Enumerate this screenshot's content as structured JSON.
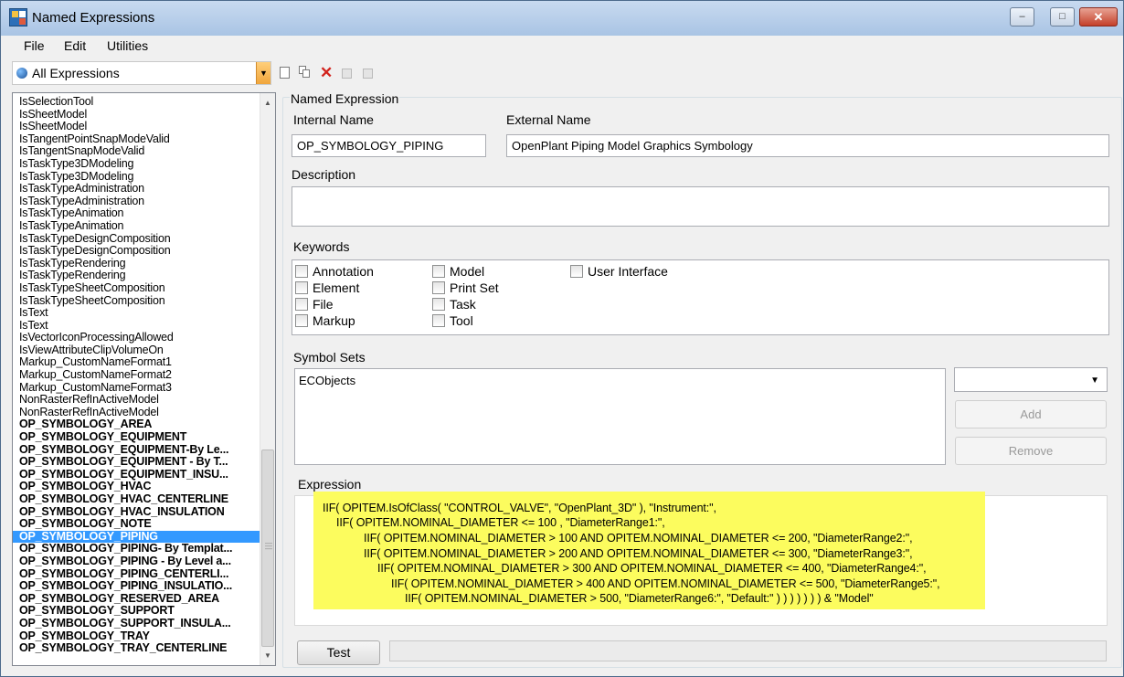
{
  "window": {
    "title": "Named Expressions",
    "controls": {
      "minimize": "–",
      "maximize": "□",
      "close": "✕"
    }
  },
  "menu": [
    "File",
    "Edit",
    "Utilities"
  ],
  "toolbar": {
    "filter_value": "All Expressions",
    "icons": [
      "new-expression-icon",
      "copy-expression-icon",
      "delete-icon",
      "save-icon",
      "save-all-icon"
    ]
  },
  "expression_list": [
    {
      "label": "IsSelectionTool",
      "bold": false
    },
    {
      "label": "IsSheetModel",
      "bold": false
    },
    {
      "label": "IsSheetModel",
      "bold": false
    },
    {
      "label": "IsTangentPointSnapModeValid",
      "bold": false
    },
    {
      "label": "IsTangentSnapModeValid",
      "bold": false
    },
    {
      "label": "IsTaskType3DModeling",
      "bold": false
    },
    {
      "label": "IsTaskType3DModeling",
      "bold": false
    },
    {
      "label": "IsTaskTypeAdministration",
      "bold": false
    },
    {
      "label": "IsTaskTypeAdministration",
      "bold": false
    },
    {
      "label": "IsTaskTypeAnimation",
      "bold": false
    },
    {
      "label": "IsTaskTypeAnimation",
      "bold": false
    },
    {
      "label": "IsTaskTypeDesignComposition",
      "bold": false
    },
    {
      "label": "IsTaskTypeDesignComposition",
      "bold": false
    },
    {
      "label": "IsTaskTypeRendering",
      "bold": false
    },
    {
      "label": "IsTaskTypeRendering",
      "bold": false
    },
    {
      "label": "IsTaskTypeSheetComposition",
      "bold": false
    },
    {
      "label": "IsTaskTypeSheetComposition",
      "bold": false
    },
    {
      "label": "IsText",
      "bold": false
    },
    {
      "label": "IsText",
      "bold": false
    },
    {
      "label": "IsVectorIconProcessingAllowed",
      "bold": false
    },
    {
      "label": "IsViewAttributeClipVolumeOn",
      "bold": false
    },
    {
      "label": "Markup_CustomNameFormat1",
      "bold": false
    },
    {
      "label": "Markup_CustomNameFormat2",
      "bold": false
    },
    {
      "label": "Markup_CustomNameFormat3",
      "bold": false
    },
    {
      "label": "NonRasterRefInActiveModel",
      "bold": false
    },
    {
      "label": "NonRasterRefInActiveModel",
      "bold": false
    },
    {
      "label": "OP_SYMBOLOGY_AREA",
      "bold": true
    },
    {
      "label": "OP_SYMBOLOGY_EQUIPMENT",
      "bold": true
    },
    {
      "label": "OP_SYMBOLOGY_EQUIPMENT-By Le...",
      "bold": true
    },
    {
      "label": "OP_SYMBOLOGY_EQUIPMENT - By T...",
      "bold": true
    },
    {
      "label": "OP_SYMBOLOGY_EQUIPMENT_INSU...",
      "bold": true
    },
    {
      "label": "OP_SYMBOLOGY_HVAC",
      "bold": true
    },
    {
      "label": "OP_SYMBOLOGY_HVAC_CENTERLINE",
      "bold": true
    },
    {
      "label": "OP_SYMBOLOGY_HVAC_INSULATION",
      "bold": true
    },
    {
      "label": "OP_SYMBOLOGY_NOTE",
      "bold": true
    },
    {
      "label": "OP_SYMBOLOGY_PIPING",
      "bold": true,
      "selected": true
    },
    {
      "label": "OP_SYMBOLOGY_PIPING- By Templat...",
      "bold": true
    },
    {
      "label": "OP_SYMBOLOGY_PIPING - By Level a...",
      "bold": true
    },
    {
      "label": "OP_SYMBOLOGY_PIPING_CENTERLI...",
      "bold": true
    },
    {
      "label": "OP_SYMBOLOGY_PIPING_INSULATIO...",
      "bold": true
    },
    {
      "label": "OP_SYMBOLOGY_RESERVED_AREA",
      "bold": true
    },
    {
      "label": "OP_SYMBOLOGY_SUPPORT",
      "bold": true
    },
    {
      "label": "OP_SYMBOLOGY_SUPPORT_INSULA...",
      "bold": true
    },
    {
      "label": "OP_SYMBOLOGY_TRAY",
      "bold": true
    },
    {
      "label": "OP_SYMBOLOGY_TRAY_CENTERLINE",
      "bold": true
    }
  ],
  "detail": {
    "group_title": "Named Expression",
    "internal_name_label": "Internal Name",
    "internal_name": "OP_SYMBOLOGY_PIPING",
    "external_name_label": "External Name",
    "external_name": "OpenPlant Piping Model Graphics Symbology",
    "description_label": "Description",
    "description": "",
    "keywords_label": "Keywords",
    "keywords": [
      {
        "label": "Annotation",
        "checked": false
      },
      {
        "label": "Element",
        "checked": false
      },
      {
        "label": "File",
        "checked": false
      },
      {
        "label": "Markup",
        "checked": false
      },
      {
        "label": "Model",
        "checked": false
      },
      {
        "label": "Print Set",
        "checked": false
      },
      {
        "label": "Task",
        "checked": false
      },
      {
        "label": "Tool",
        "checked": false
      },
      {
        "label": "User Interface",
        "checked": false
      }
    ],
    "symbol_sets_label": "Symbol Sets",
    "symbol_sets": [
      "ECObjects"
    ],
    "symbol_combo_value": "",
    "add_label": "Add",
    "remove_label": "Remove",
    "expression_label": "Expression",
    "expression_lines": [
      "IIF( OPITEM.IsOfClass( \"CONTROL_VALVE\", \"OpenPlant_3D\" ), \"Instrument:\",",
      "IIF( OPITEM.NOMINAL_DIAMETER <= 100 , \"DiameterRange1:\",",
      "IIF( OPITEM.NOMINAL_DIAMETER > 100 AND OPITEM.NOMINAL_DIAMETER <= 200, \"DiameterRange2:\",",
      "IIF( OPITEM.NOMINAL_DIAMETER > 200 AND OPITEM.NOMINAL_DIAMETER <= 300, \"DiameterRange3:\",",
      "IIF( OPITEM.NOMINAL_DIAMETER > 300 AND OPITEM.NOMINAL_DIAMETER <= 400, \"DiameterRange4:\",",
      "IIF( OPITEM.NOMINAL_DIAMETER > 400 AND OPITEM.NOMINAL_DIAMETER <= 500, \"DiameterRange5:\",",
      "IIF( OPITEM.NOMINAL_DIAMETER > 500, \"DiameterRange6:\", \"Default:\" ) ) ) ) ) ) ) & \"Model\""
    ],
    "test_label": "Test",
    "status_text": ""
  },
  "colors": {
    "selection": "#3399ff",
    "expression_highlight": "#fcfc5e",
    "delete_icon": "#d2231d"
  }
}
